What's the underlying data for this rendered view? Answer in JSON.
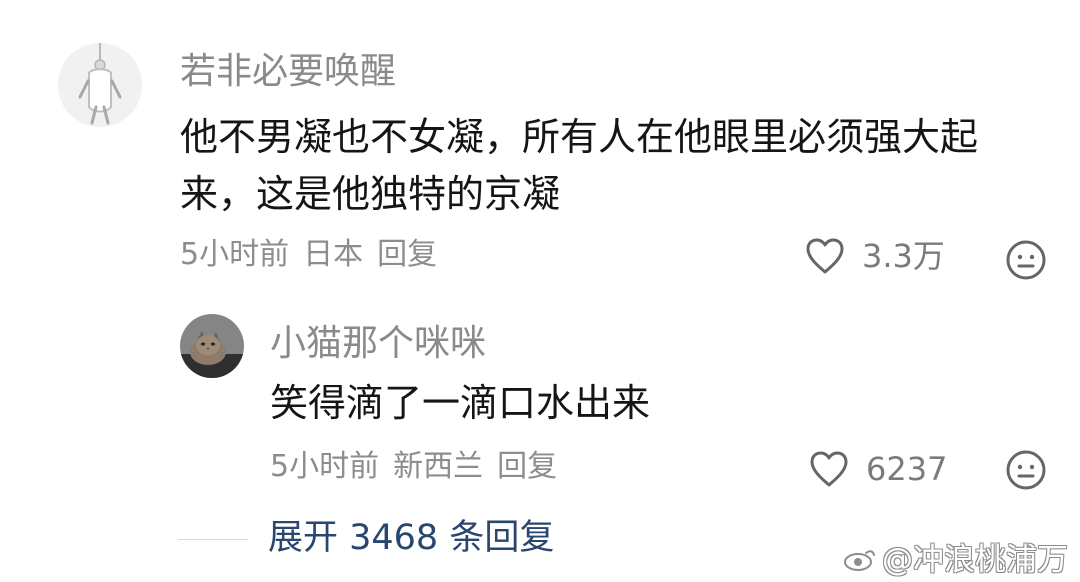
{
  "comments": [
    {
      "username": "若非必要唤醒",
      "content_line_1": "他不男凝也不女凝，所有人在他眼里必须强大起",
      "content_line_2": "来，这是他独特的京凝",
      "time": "5小时前",
      "location": "日本",
      "reply_label": "回复",
      "likes": "3.3万",
      "icons": {
        "avatar": "hanging-figure-avatar",
        "like": "heart-outline-icon",
        "emoji": "neutral-face-icon"
      }
    },
    {
      "username": "小猫那个咪咪",
      "content": "笑得滴了一滴口水出来",
      "time": "5小时前",
      "location": "新西兰",
      "reply_label": "回复",
      "likes": "6237",
      "icons": {
        "avatar": "cat-avatar",
        "like": "heart-outline-icon",
        "emoji": "neutral-face-icon"
      }
    }
  ],
  "expand_replies": {
    "label": "展开 3468 条回复"
  },
  "watermark": {
    "text": "@冲浪桃浦万",
    "icon": "weibo-eye-icon"
  },
  "colors": {
    "username": "#8a8a8a",
    "content": "#151515",
    "meta": "#8d8d8d",
    "expand": "#29466d",
    "icon": "#666666"
  }
}
